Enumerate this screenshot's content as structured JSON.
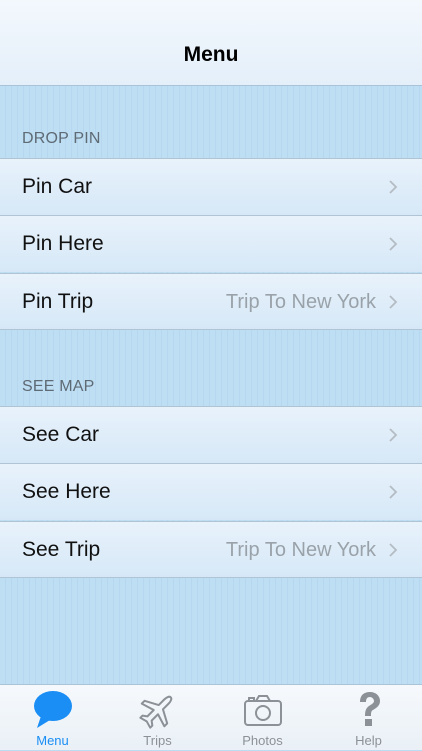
{
  "navbar": {
    "title": "Menu"
  },
  "sections": {
    "drop_pin": {
      "header": "DROP PIN",
      "rows": [
        {
          "label": "Pin Car",
          "detail": ""
        },
        {
          "label": "Pin Here",
          "detail": ""
        },
        {
          "label": "Pin Trip",
          "detail": "Trip To New York"
        }
      ]
    },
    "see_map": {
      "header": "SEE MAP",
      "rows": [
        {
          "label": "See Car",
          "detail": ""
        },
        {
          "label": "See Here",
          "detail": ""
        },
        {
          "label": "See Trip",
          "detail": "Trip To New York"
        }
      ]
    }
  },
  "tabbar": {
    "tabs": [
      {
        "label": "Menu",
        "icon": "speech-bubble-icon",
        "active": true
      },
      {
        "label": "Trips",
        "icon": "airplane-icon",
        "active": false
      },
      {
        "label": "Photos",
        "icon": "camera-icon",
        "active": false
      },
      {
        "label": "Help",
        "icon": "question-mark-icon",
        "active": false
      }
    ]
  },
  "colors": {
    "accent": "#1a8ef5",
    "background": "#bcdcf2",
    "tab_inactive": "#8b9197"
  }
}
